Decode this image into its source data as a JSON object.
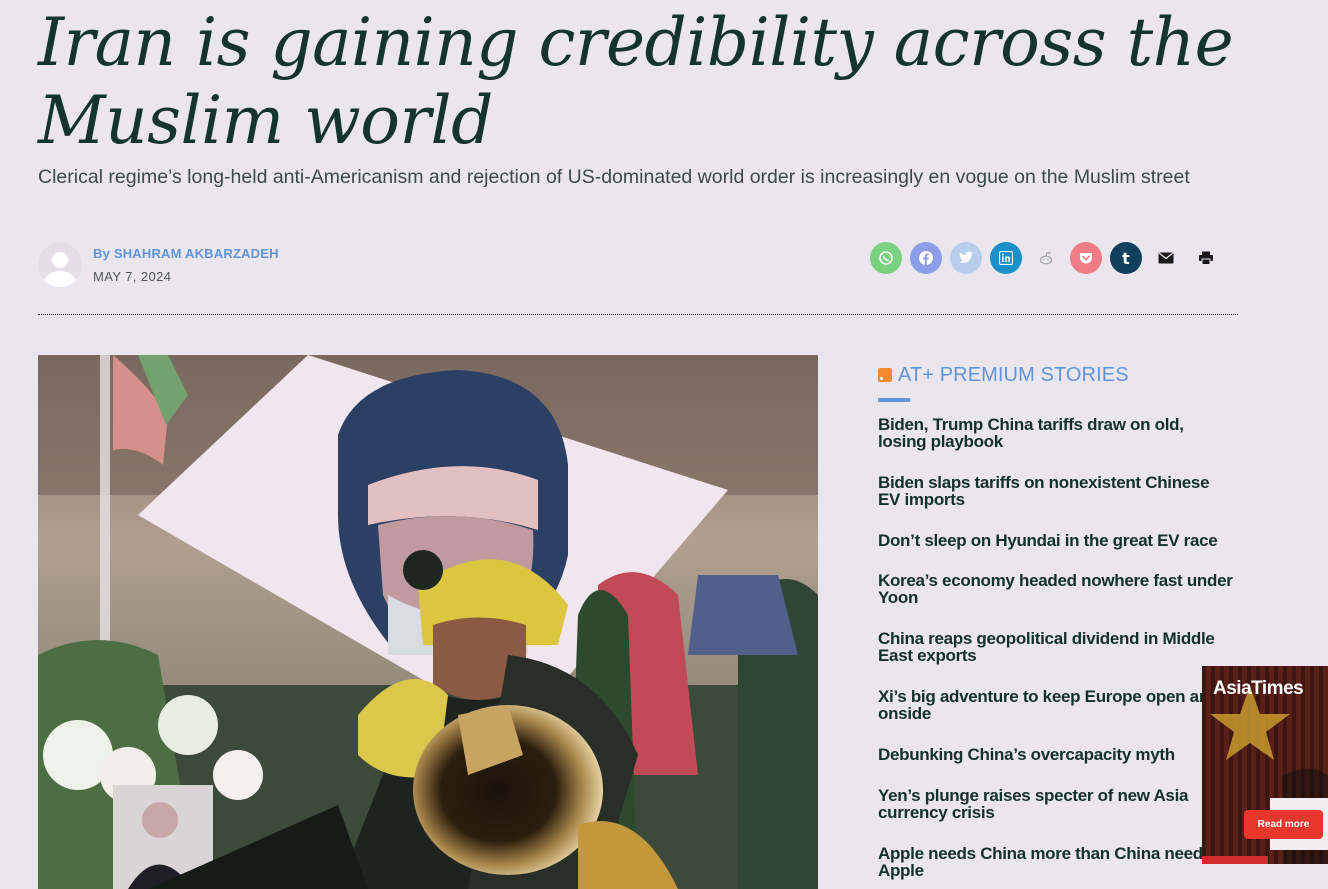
{
  "article": {
    "headline": "Iran is gaining credibility across the Muslim world",
    "subheadline": "Clerical regime’s long-held anti-Americanism and rejection of US-dominated world order is increasingly en vogue on the Muslim street",
    "author": "By SHAHRAM AKBARZADEH",
    "date": "MAY 7, 2024"
  },
  "share_icons": [
    {
      "icon": "whatsapp-icon",
      "color": "#7ad17f"
    },
    {
      "icon": "facebook-icon",
      "color": "#8d9ee8"
    },
    {
      "icon": "twitter-icon",
      "color": "#b7cdeb"
    },
    {
      "icon": "linkedin-icon",
      "color": "#1a8fc9"
    },
    {
      "icon": "reddit-icon",
      "color": "#ebe6ee"
    },
    {
      "icon": "pocket-icon",
      "color": "#f07d86"
    },
    {
      "icon": "tumblr-icon",
      "color": "#11405e"
    },
    {
      "icon": "email-icon",
      "color": "#ebe6ee"
    },
    {
      "icon": "print-icon",
      "color": "#ebe6ee"
    }
  ],
  "sidebar": {
    "title": "AT+ PREMIUM STORIES",
    "stories": [
      "Biden, Trump China tariffs draw on old, losing playbook",
      "Biden slaps tariffs on nonexistent Chinese EV imports",
      "Don’t sleep on Hyundai in the great EV race",
      "Korea’s economy headed nowhere fast under Yoon",
      "China reaps geopolitical dividend in Middle East exports",
      "Xi’s big adventure to keep Europe open and onside",
      "Debunking China’s overcapacity myth",
      "Yen’s plunge raises specter of new Asia currency crisis",
      "Apple needs China more than China needs Apple"
    ]
  },
  "ad": {
    "logo": "AsiaTimes",
    "button": "Read more"
  }
}
